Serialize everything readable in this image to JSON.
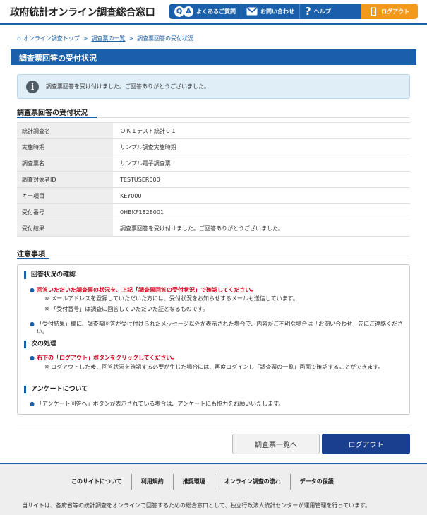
{
  "header": {
    "site_title": "政府統計オンライン調査総合窓口",
    "nav": {
      "faq": "よくあるご質問",
      "contact": "お問い合わせ",
      "help": "ヘルプ",
      "logout": "ログアウト"
    },
    "accent": "#1a5fa9",
    "logout_color": "#f39a1c"
  },
  "breadcrumb": {
    "items": [
      "オンライン調査トップ",
      "調査票の一覧",
      "調査票回答の受付状況"
    ],
    "separator": ">"
  },
  "page_title": "調査票回答の受付状況",
  "info_message": "調査票回答を受け付けました。ご回答ありがとうございました。",
  "status_section": {
    "heading": "調査票回答の受付状況",
    "rows": [
      {
        "label": "統計調査名",
        "value": "ＯＫＩテスト統計０１"
      },
      {
        "label": "実施時期",
        "value": "サンプル調査実施時期"
      },
      {
        "label": "調査票名",
        "value": "サンプル電子調査票"
      },
      {
        "label": "調査対象者ID",
        "value": "TESTUSER000"
      },
      {
        "label": "キー項目",
        "value": "KEY000"
      },
      {
        "label": "受付番号",
        "value": "0HBKF1828001"
      },
      {
        "label": "受付結果",
        "value": "調査票回答を受け付けました。ご回答ありがとうございました。"
      }
    ]
  },
  "notes": {
    "heading": "注意事項",
    "sections": [
      {
        "title": "回答状況の確認",
        "bullets": [
          {
            "text": "回答いただいた調査票の状況を、上記「調査票回答の受付状況」で確認してください。",
            "highlight": true,
            "subs": [
              "※ メールアドレスを登録していただいた方には、受付状況をお知らせするメールも送信しています。",
              "※ 「受付番号」は調査に回答していただいた証となるものです。"
            ]
          },
          {
            "text": "「受付結果」欄に、調査票回答が受け付けられたメッセージ以外が表示された場合で、内容がご不明な場合は「お問い合わせ」先にご連絡ください。",
            "highlight": false,
            "subs": []
          }
        ]
      },
      {
        "title": "次の処理",
        "bullets": [
          {
            "text": "右下の「ログアウト」ボタンをクリックしてください。",
            "highlight": true,
            "subs": [
              "※ ログアウトした後、回答状況を確認する必要が生じた場合には、再度ログインし「調査票の一覧」画面で確認することができます。"
            ]
          }
        ]
      },
      {
        "title": "アンケートについて",
        "bullets": [
          {
            "text": "「アンケート回答へ」ボタンが表示されている場合は、アンケートにも協力をお願いいたします。",
            "highlight": false,
            "subs": []
          }
        ]
      }
    ]
  },
  "buttons": {
    "survey_list": "調査票一覧へ",
    "logout": "ログアウト"
  },
  "footer": {
    "links": [
      "このサイトについて",
      "利用規約",
      "推奨環境",
      "オンライン調査の流れ",
      "データの保護"
    ],
    "note": "当サイトは、各府省等の統計調査をオンラインで回答するための総合窓口として、独立行政法人統計センターが運用管理を行っています。"
  }
}
